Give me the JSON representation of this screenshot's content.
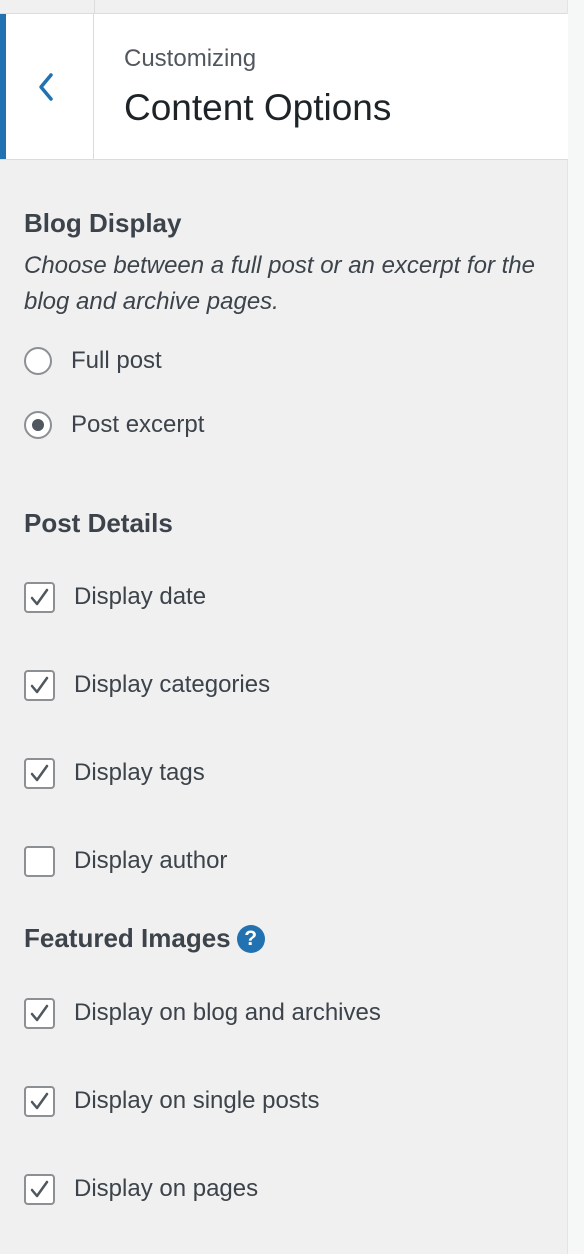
{
  "header": {
    "subtitle": "Customizing",
    "title": "Content Options",
    "accent_color": "#2271b1",
    "back_icon": "chevron-left-icon"
  },
  "blog_display": {
    "title": "Blog Display",
    "description": "Choose between a full post or an excerpt for the blog and archive pages.",
    "options": [
      {
        "label": "Full post",
        "checked": false
      },
      {
        "label": "Post excerpt",
        "checked": true
      }
    ]
  },
  "post_details": {
    "title": "Post Details",
    "options": [
      {
        "label": "Display date",
        "checked": true
      },
      {
        "label": "Display categories",
        "checked": true
      },
      {
        "label": "Display tags",
        "checked": true
      },
      {
        "label": "Display author",
        "checked": false
      }
    ]
  },
  "featured_images": {
    "title": "Featured Images",
    "help_icon": "question-mark-icon",
    "help_glyph": "?",
    "options": [
      {
        "label": "Display on blog and archives",
        "checked": true
      },
      {
        "label": "Display on single posts",
        "checked": true
      },
      {
        "label": "Display on pages",
        "checked": true
      }
    ]
  }
}
